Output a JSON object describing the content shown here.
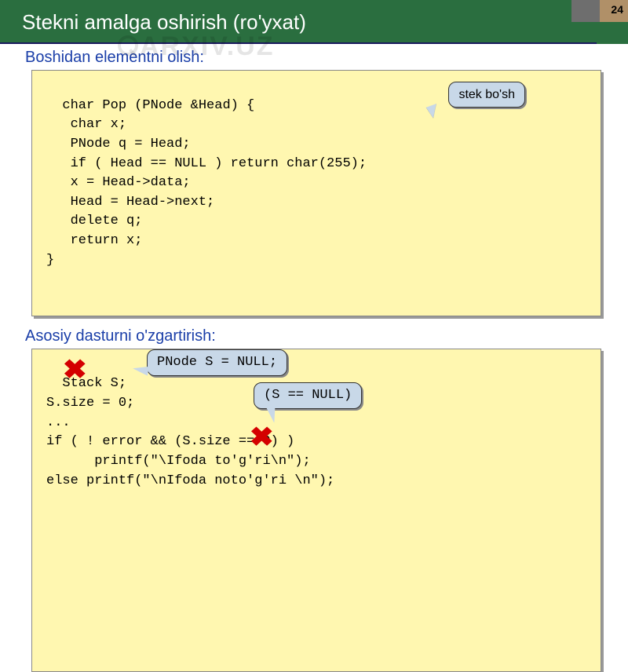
{
  "page_number": "24",
  "title": "Stekni amalga oshirish (ro'yxat)",
  "watermark_text": "ARXIV.UZ",
  "section1_label": "Boshidan elementni olish:",
  "code1": "char Pop (PNode &Head) {\n   char x;\n   PNode q = Head;\n   if ( Head == NULL ) return char(255);\n   x = Head->data;\n   Head = Head->next;\n   delete q;\n   return x;\n}",
  "callout1": "stek bo'sh",
  "section2_label": "Asosiy dasturni o'zgartirish:",
  "code2": "Stack S;\nS.size = 0;\n...\nif ( ! error && (S.size == 0) )\n      printf(\"\\Ifoda to'g'ri\\n\");\nelse printf(\"\\nIfoda noto'g'ri \\n\");",
  "callout2": "PNode S = NULL;",
  "callout3": "(S == NULL)"
}
